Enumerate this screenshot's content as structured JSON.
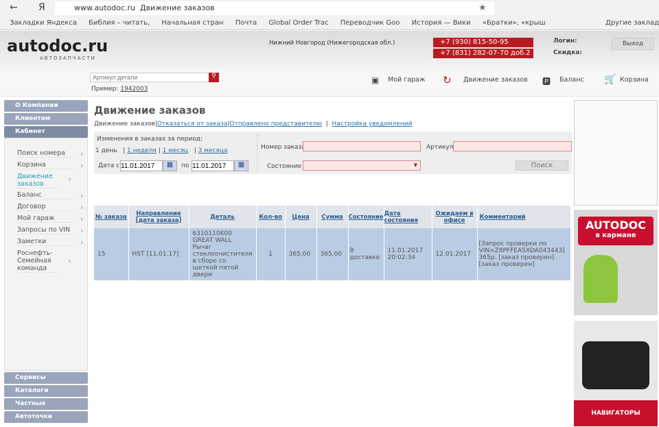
{
  "browser": {
    "url": "www.autodoc.ru",
    "page_title": "Движение заказов",
    "bookmarks": [
      "Закладки Яндекса",
      "Библия – читать,",
      "Начальная стран",
      "Почта",
      "Global Order Trac",
      "Переводчик Goo",
      "История — Вики",
      "«Братки», «крыш"
    ],
    "other_bookmarks": "Другие закладки"
  },
  "header": {
    "logo": "autodoc.ru",
    "logo_sub": "АВТОЗАПЧАСТИ",
    "region": "Нижний Новгород (Нижегородская обл.)",
    "phones": [
      "+7 (930) 815-50-95",
      "+7 (831) 282-07-70 доб.2"
    ],
    "login_label": "Логин:",
    "discount_label": "Скидка:",
    "logout": "Выход"
  },
  "search": {
    "placeholder": "Артикул детали",
    "example_label": "Пример:",
    "example": "1942003"
  },
  "nav": [
    "Мой гараж",
    "Движение заказов",
    "Баланс",
    "Корзина"
  ],
  "sidebar": {
    "sections_top": [
      "О Компании",
      "Клиентам",
      "Кабинет"
    ],
    "items": [
      "Поиск номера",
      "Корзина",
      "Движение заказов",
      "Баланс",
      "Договор",
      "Мой гараж",
      "Запросы по VIN",
      "Заметки",
      "Роснефть-Семейная команда"
    ],
    "sections_bottom": [
      "Сервисы",
      "Каталоги",
      "Частные объявления",
      "Автоточки"
    ]
  },
  "main": {
    "title": "Движение заказов",
    "subnav": [
      "Движение заказов",
      "Отказаться от заказа",
      "Отправлено представителю",
      "Настройка уведомлений"
    ],
    "filter": {
      "period_label": "Изменения в заказах за период:",
      "periods": [
        "1 день",
        "1 неделя",
        "1 месяц",
        "3 месяца"
      ],
      "date_from_label": "Дата с",
      "date_from": "11.01.2017",
      "date_to_label": "по",
      "date_to": "11.01.2017",
      "order_no_label": "Номер заказа",
      "article_label": "Артикул",
      "state_label": "Состояние",
      "search_button": "Поиск"
    },
    "table": {
      "headers": [
        "№ заказа",
        "Направление [дата заказа]",
        "Деталь",
        "Кол-во",
        "Цена",
        "Сумма",
        "Состояние",
        "Дата состояния",
        "Ожидаем в офисе",
        "Комментарий"
      ],
      "rows": [
        [
          "15",
          "HST [11.01.17]",
          "6310110K00 GREAT WALL Рычаг стеклоочистителя в сборе со щеткой пятой двери",
          "1",
          "365,00",
          "365,00",
          "В доставке",
          "11.01.2017 20:02:34",
          "12.01.2017",
          "[Запрос проверки по VIN=Z8PFFEA5XDA043443] 365р. [заказ проверен] [заказ проверен]"
        ]
      ]
    }
  },
  "ads": {
    "app_title": "AUTODOC",
    "app_sub": "в кармане",
    "nav_label": "НАВИГАТОРЫ"
  },
  "colors": {
    "brand_red": "#b81c22",
    "sidebar": "#9aa5bb",
    "row": "#b9cce4",
    "link": "#2a6fa8"
  }
}
